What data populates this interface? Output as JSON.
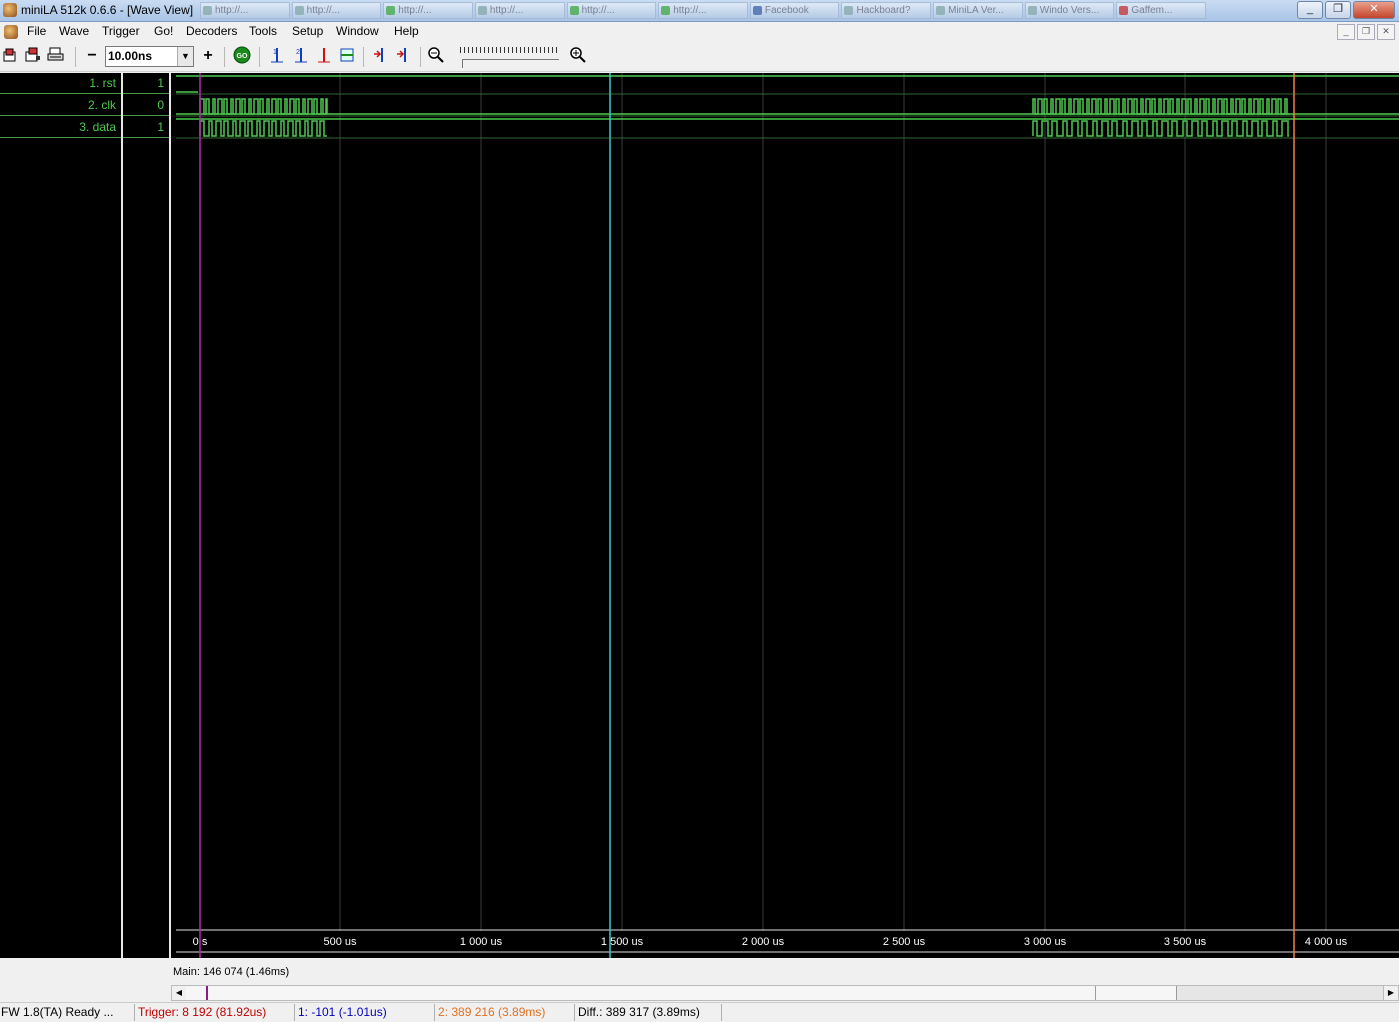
{
  "window": {
    "title": "miniLA 512k 0.6.6 - [Wave View]",
    "taskbar_items": [
      "http://...",
      "http://...",
      "http://...",
      "http://...",
      "http://...",
      "http://...",
      "Facebook",
      "Hackboard?",
      "MiniLA Ver...",
      "Windo Vers...",
      "Gaffem..."
    ],
    "controls": [
      "_",
      "❐",
      "✕"
    ]
  },
  "menu": {
    "items": [
      "File",
      "Wave",
      "Trigger",
      "Go!",
      "Decoders",
      "Tools",
      "Setup",
      "Window",
      "Help"
    ],
    "mdi_controls": [
      "_",
      "❐",
      "✕"
    ]
  },
  "toolbar": {
    "zoom_value": "10.00ns",
    "zoom_out_label": "−",
    "zoom_in_label": "+",
    "go_label": "GO"
  },
  "signals": [
    {
      "name": "1. rst",
      "value": "1"
    },
    {
      "name": "2. clk",
      "value": "0"
    },
    {
      "name": "3. data",
      "value": "1"
    }
  ],
  "timeline": {
    "labels": [
      "0 s",
      "500 us",
      "1 000 us",
      "1 500 us",
      "2 000 us",
      "2 500 us",
      "3 000 us",
      "3 500 us",
      "4 000 us"
    ],
    "cursor_colors": {
      "trigger": "#b02ab0",
      "cursor1": "#3cc8c8",
      "cursor2": "#f08040"
    }
  },
  "main_info": "Main: 146 074  (1.46ms)",
  "status": {
    "fw": "FW 1.8(TA) Ready ...",
    "trigger": "Trigger: 8 192  (81.92us)",
    "cursor1": "1: -101  (-1.01us)",
    "cursor2": "2: 389 216  (3.89ms)",
    "diff": "Diff.: 389 317  (3.89ms)"
  },
  "colors": {
    "trace": "#4ec84e",
    "trigger_text": "#c00000",
    "cursor1_text": "#0000c0",
    "cursor2_text": "#e07020"
  }
}
